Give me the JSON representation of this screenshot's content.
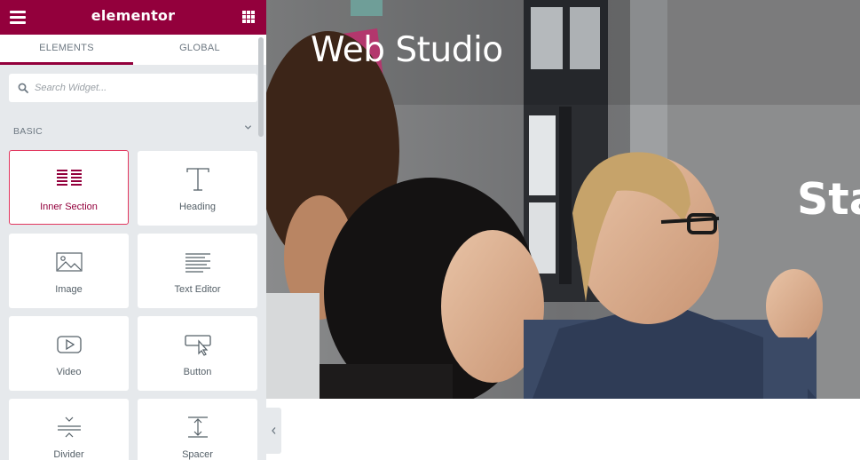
{
  "app": {
    "logo": "elementor"
  },
  "icons": {
    "menu": "hamburger-menu-icon",
    "apps": "grid-apps-icon",
    "search": "search-icon",
    "category_toggle": "chevron-down-icon",
    "panel_toggle": "chevron-left-icon"
  },
  "tabs": [
    {
      "label": "ELEMENTS",
      "active": true
    },
    {
      "label": "GLOBAL",
      "active": false
    }
  ],
  "search": {
    "placeholder": "Search Widget..."
  },
  "category": {
    "title": "BASIC"
  },
  "widgets": [
    {
      "label": "Inner Section",
      "icon": "inner-section-icon",
      "active": true
    },
    {
      "label": "Heading",
      "icon": "heading-icon",
      "active": false
    },
    {
      "label": "Image",
      "icon": "image-icon",
      "active": false
    },
    {
      "label": "Text Editor",
      "icon": "text-editor-icon",
      "active": false
    },
    {
      "label": "Video",
      "icon": "video-icon",
      "active": false
    },
    {
      "label": "Button",
      "icon": "button-icon",
      "active": false
    },
    {
      "label": "Divider",
      "icon": "divider-icon",
      "active": false
    },
    {
      "label": "Spacer",
      "icon": "spacer-icon",
      "active": false
    }
  ],
  "preview": {
    "site_title": "Web Studio",
    "hero_heading": "Sta"
  },
  "colors": {
    "brand": "#93003c",
    "active_border": "#e2365e",
    "panel_bg": "#e6e9ec"
  }
}
